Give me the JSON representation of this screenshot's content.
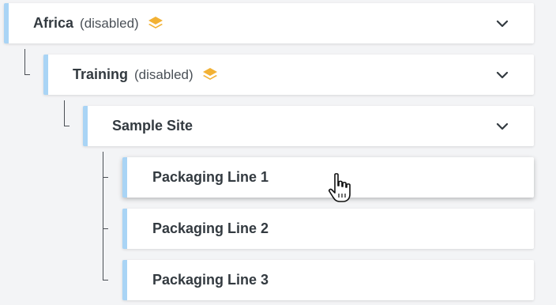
{
  "tree": {
    "africa": {
      "label": "Africa",
      "status": "(disabled)",
      "layers_icon": "layers-icon",
      "chevron_icon": "chevron-down-icon"
    },
    "training": {
      "label": "Training",
      "status": "(disabled)",
      "layers_icon": "layers-icon",
      "chevron_icon": "chevron-down-icon"
    },
    "sample_site": {
      "label": "Sample Site",
      "chevron_icon": "chevron-down-icon"
    },
    "lines": [
      {
        "label": "Packaging Line 1"
      },
      {
        "label": "Packaging Line 2"
      },
      {
        "label": "Packaging Line 3"
      }
    ]
  },
  "colors": {
    "accent_bar": "#a9d4f5",
    "layers_icon": "#f2b134",
    "background": "#f3f4f6"
  },
  "cursor": {
    "icon": "hand-pointer-cursor"
  }
}
